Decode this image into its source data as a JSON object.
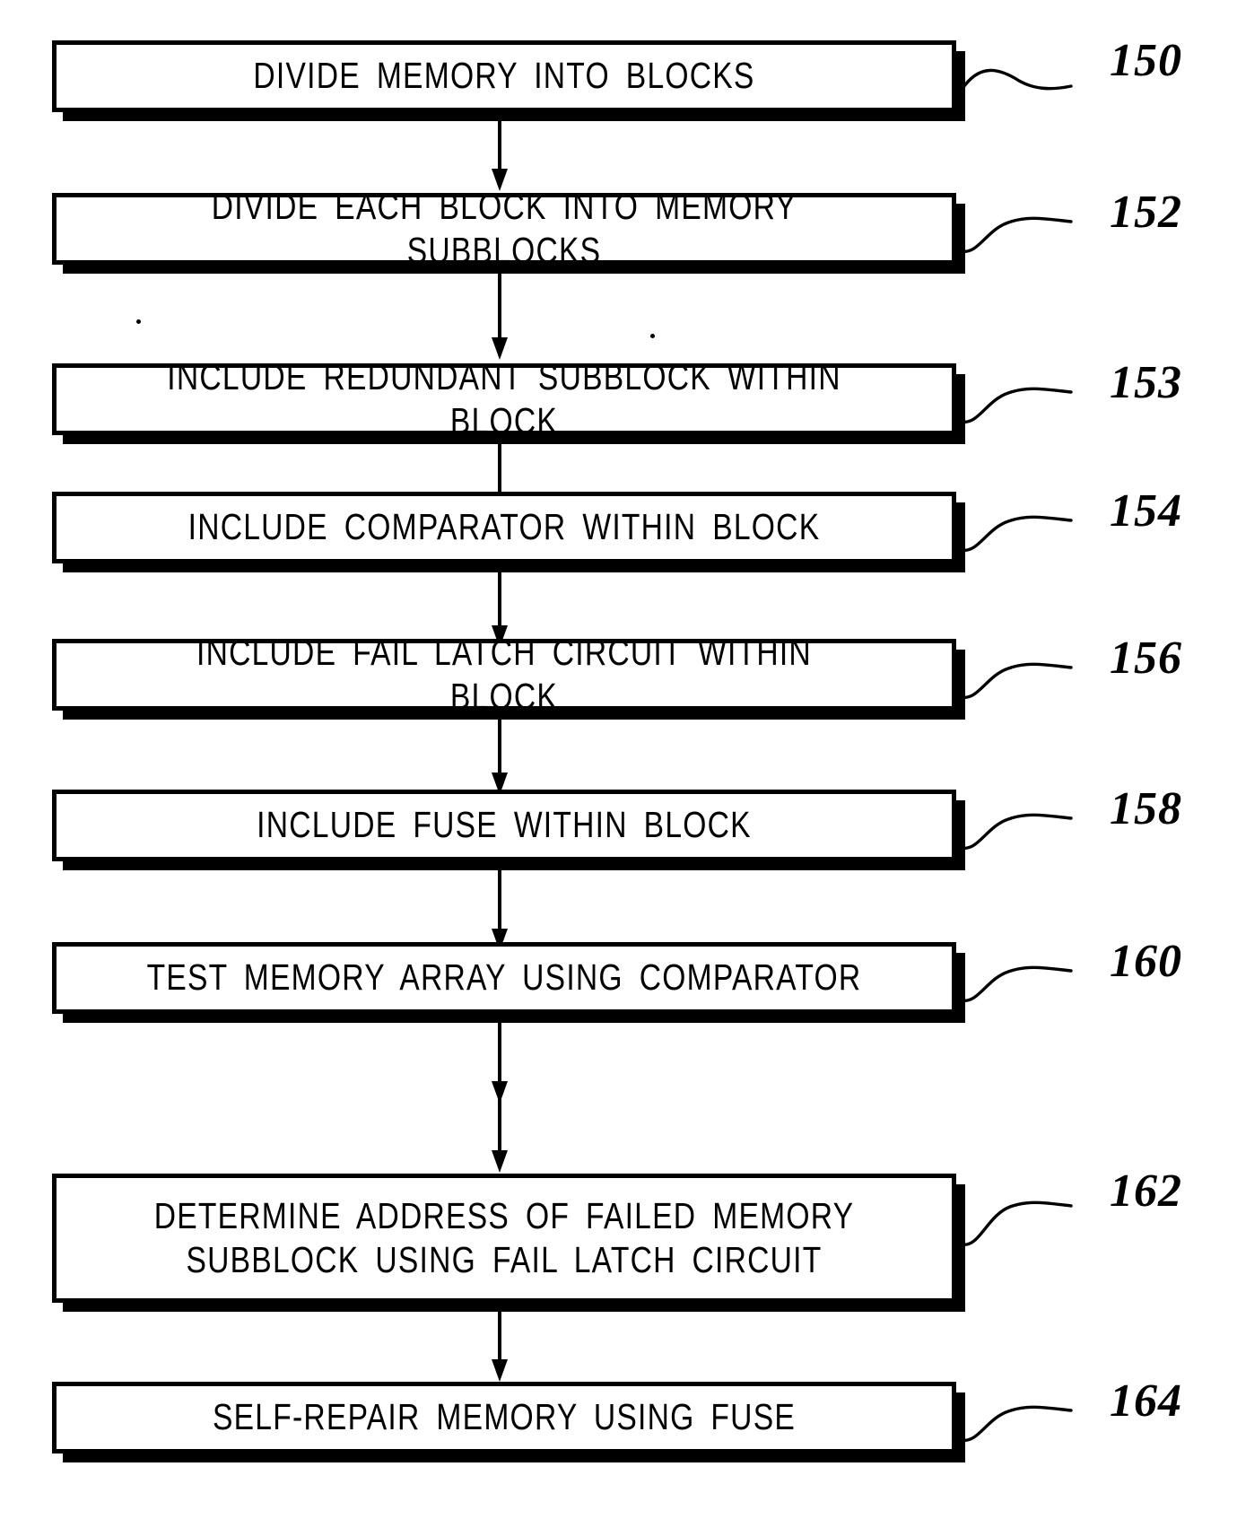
{
  "figure": {
    "type": "patent-flowchart",
    "background_color": "#ffffff",
    "line_color": "#000000",
    "steps": [
      {
        "ref": "150",
        "text": "DIVIDE MEMORY INTO BLOCKS"
      },
      {
        "ref": "152",
        "text": "DIVIDE EACH BLOCK INTO MEMORY SUBBLOCKS"
      },
      {
        "ref": "153",
        "text": "INCLUDE REDUNDANT SUBBLOCK WITHIN BLOCK"
      },
      {
        "ref": "154",
        "text": "INCLUDE COMPARATOR WITHIN BLOCK"
      },
      {
        "ref": "156",
        "text": "INCLUDE FAIL LATCH CIRCUIT WITHIN BLOCK"
      },
      {
        "ref": "158",
        "text": "INCLUDE FUSE WITHIN BLOCK"
      },
      {
        "ref": "160",
        "text": "TEST MEMORY ARRAY USING COMPARATOR"
      },
      {
        "ref": "162",
        "text": "DETERMINE ADDRESS OF FAILED MEMORY\nSUBBLOCK USING FAIL LATCH CIRCUIT"
      },
      {
        "ref": "164",
        "text": "SELF-REPAIR MEMORY USING FUSE"
      }
    ],
    "connectors": [
      {
        "from": "150",
        "to": "152"
      },
      {
        "from": "152",
        "to": "153"
      },
      {
        "from": "153",
        "to": "154"
      },
      {
        "from": "154",
        "to": "156"
      },
      {
        "from": "156",
        "to": "158"
      },
      {
        "from": "158",
        "to": "160"
      },
      {
        "from": "160",
        "to": "162"
      },
      {
        "from": "162",
        "to": "164"
      }
    ]
  }
}
